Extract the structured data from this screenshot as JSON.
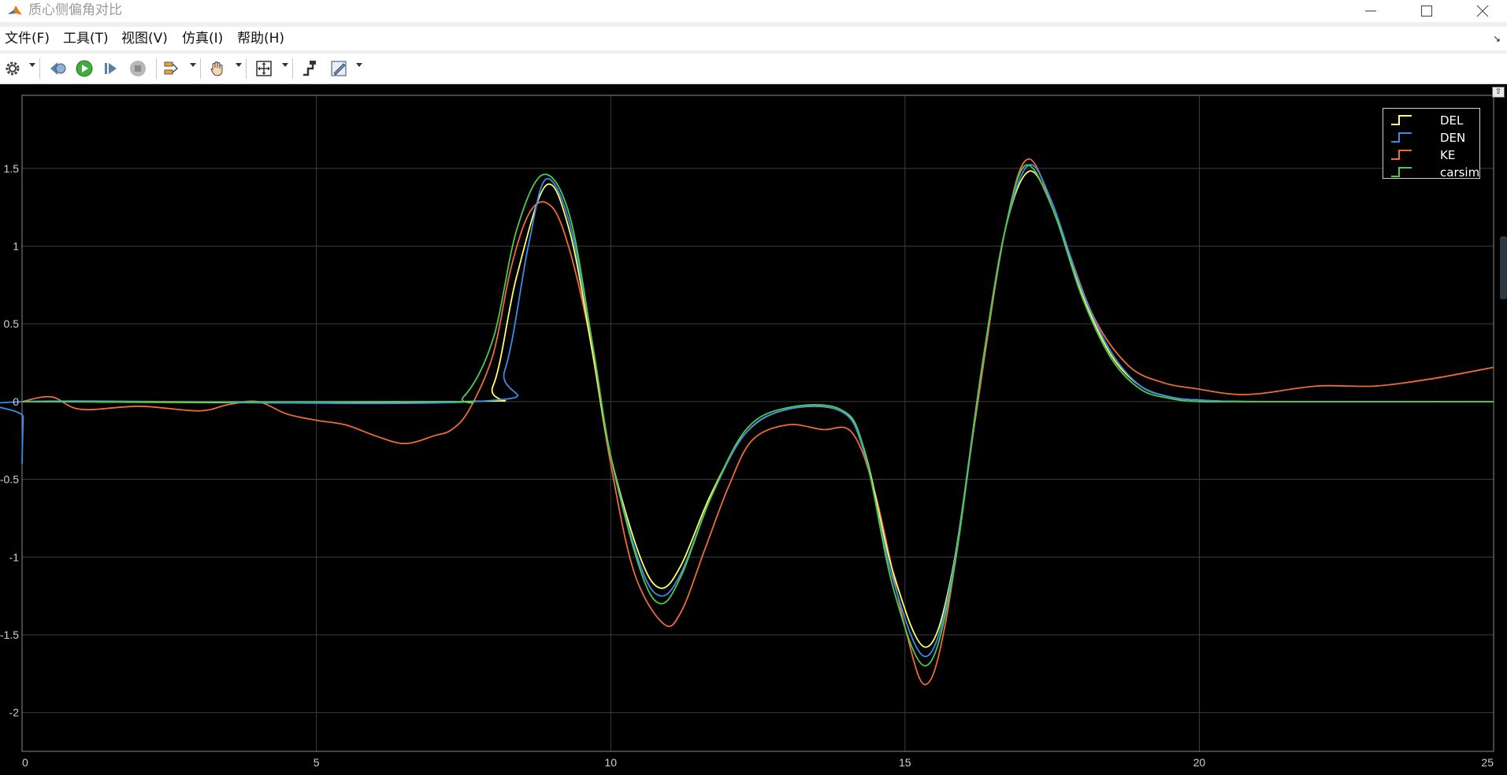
{
  "window": {
    "title": "质心侧偏角对比",
    "controls": [
      "minimize-icon",
      "maximize-icon",
      "close-icon"
    ]
  },
  "menu": {
    "items": [
      "文件(F)",
      "工具(T)",
      "视图(V)",
      "仿真(I)",
      "帮助(H)"
    ]
  },
  "toolbar": {
    "buttons": [
      "settings-gear-icon",
      "step-back-icon",
      "run-icon",
      "step-forward-icon",
      "stop-icon",
      "signal-highlight-icon",
      "pan-icon",
      "zoom-fit-icon",
      "cursor-measure-icon",
      "triggers-icon"
    ]
  },
  "colors": {
    "plot_bg": "#000000",
    "grid": "#3c3c3c",
    "tick_text": "#d0d0d0",
    "DEL": "#ffff66",
    "DEN": "#3b8ce8",
    "KE": "#ee6a3a",
    "carsim": "#4ec94e"
  },
  "chart_data": {
    "type": "line",
    "title": "",
    "xlabel": "",
    "ylabel": "",
    "xlim": [
      0,
      25
    ],
    "ylim": [
      -2.25,
      1.97
    ],
    "xticks": [
      "0",
      "5",
      "10",
      "15",
      "20",
      "25"
    ],
    "yticks": [
      "1.5",
      "1",
      "0.5",
      "0",
      "-0.5",
      "-1",
      "-1.5",
      "-2"
    ],
    "grid": true,
    "legend_position": "top-right",
    "series": [
      {
        "name": "DEL",
        "x": [
          0,
          7.5,
          8,
          8.4,
          8.9,
          9.3,
          9.7,
          10.0,
          10.5,
          10.85,
          11.2,
          11.7,
          12.3,
          13.0,
          13.9,
          14.3,
          14.8,
          15.35,
          15.8,
          16.3,
          16.7,
          17.1,
          17.5,
          18.0,
          18.5,
          19.0,
          19.5,
          20.0,
          21.0,
          25.0
        ],
        "y": [
          0,
          0,
          0.1,
          0.8,
          1.39,
          1.1,
          0.3,
          -0.35,
          -1.0,
          -1.2,
          -1.05,
          -0.6,
          -0.2,
          -0.05,
          -0.06,
          -0.3,
          -1.1,
          -1.58,
          -1.1,
          0.2,
          1.1,
          1.48,
          1.25,
          0.7,
          0.3,
          0.1,
          0.03,
          0.01,
          0,
          0
        ]
      },
      {
        "name": "DEN",
        "x": [
          0,
          0.02,
          0.05,
          7.7,
          8.2,
          8.6,
          8.9,
          9.3,
          9.7,
          10.0,
          10.5,
          10.85,
          11.2,
          11.7,
          12.3,
          13.0,
          13.9,
          14.3,
          14.8,
          15.35,
          15.8,
          16.3,
          16.7,
          17.1,
          17.5,
          18.0,
          18.5,
          19.0,
          19.5,
          20.0,
          21.0,
          25.0
        ],
        "y": [
          -0.4,
          -0.1,
          0,
          0,
          0.2,
          1.0,
          1.43,
          1.15,
          0.35,
          -0.35,
          -1.05,
          -1.25,
          -1.1,
          -0.62,
          -0.2,
          -0.05,
          -0.06,
          -0.32,
          -1.15,
          -1.64,
          -1.12,
          0.2,
          1.1,
          1.52,
          1.28,
          0.72,
          0.32,
          0.1,
          0.03,
          0.01,
          0,
          0
        ]
      },
      {
        "name": "KE",
        "x": [
          0,
          0.5,
          1,
          2,
          3,
          3.5,
          4,
          4.5,
          5,
          5.5,
          6,
          6.5,
          7,
          7.3,
          7.6,
          8.0,
          8.3,
          8.6,
          8.9,
          9.2,
          9.6,
          10.0,
          10.4,
          10.9,
          11.2,
          11.6,
          12.0,
          12.4,
          13.0,
          13.6,
          14.1,
          14.5,
          15.0,
          15.35,
          15.7,
          16.2,
          16.7,
          17.1,
          17.6,
          18.2,
          18.8,
          19.4,
          20.0,
          20.5,
          21.0,
          22.0,
          23.0,
          24.0,
          25.0
        ],
        "y": [
          0,
          0.03,
          -0.05,
          -0.03,
          -0.06,
          -0.02,
          0.0,
          -0.08,
          -0.12,
          -0.15,
          -0.22,
          -0.27,
          -0.22,
          -0.18,
          -0.05,
          0.3,
          0.85,
          1.2,
          1.28,
          1.1,
          0.5,
          -0.4,
          -1.1,
          -1.43,
          -1.35,
          -0.95,
          -0.55,
          -0.25,
          -0.15,
          -0.18,
          -0.2,
          -0.6,
          -1.45,
          -1.82,
          -1.4,
          -0.1,
          1.1,
          1.56,
          1.15,
          0.55,
          0.23,
          0.12,
          0.08,
          0.05,
          0.05,
          0.1,
          0.1,
          0.15,
          0.22
        ]
      },
      {
        "name": "carsim",
        "x": [
          0,
          7.0,
          7.5,
          8.0,
          8.4,
          8.85,
          9.3,
          9.7,
          10.0,
          10.5,
          10.85,
          11.2,
          11.7,
          12.3,
          13.0,
          13.9,
          14.3,
          14.8,
          15.35,
          15.8,
          16.3,
          16.7,
          17.05,
          17.5,
          18.0,
          18.5,
          19.0,
          19.5,
          20.0,
          21.0,
          25.0
        ],
        "y": [
          0,
          0,
          0.03,
          0.4,
          1.1,
          1.46,
          1.2,
          0.35,
          -0.35,
          -1.08,
          -1.3,
          -1.12,
          -0.62,
          -0.18,
          -0.04,
          -0.05,
          -0.3,
          -1.2,
          -1.7,
          -1.15,
          0.2,
          1.1,
          1.52,
          1.25,
          0.68,
          0.28,
          0.08,
          0.02,
          0.0,
          0,
          0
        ]
      }
    ]
  }
}
